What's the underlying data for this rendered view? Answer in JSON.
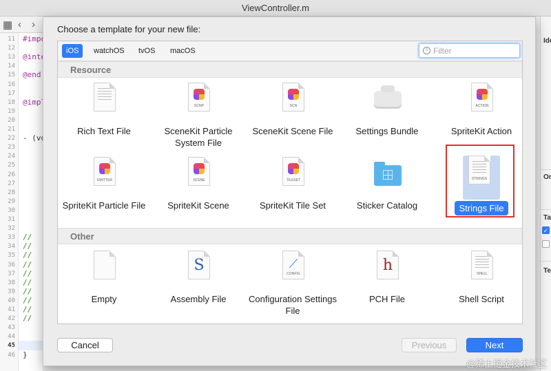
{
  "window": {
    "title": "ViewController.m"
  },
  "editor": {
    "line_numbers": [
      "11",
      "12",
      "13",
      "14",
      "15",
      "16",
      "17",
      "18",
      "19",
      "20",
      "21",
      "22",
      "23",
      "24",
      "25",
      "26",
      "27",
      "28",
      "29",
      "30",
      "31",
      "32",
      "33",
      "34",
      "35",
      "36",
      "37",
      "38",
      "39",
      "40",
      "41",
      "42",
      "43",
      "44",
      "45",
      "46"
    ],
    "current_line": "45",
    "code_fragments": [
      {
        "line": "11",
        "text": "#impo",
        "style": "kw"
      },
      {
        "line": "13",
        "text": "@inte",
        "style": "kw"
      },
      {
        "line": "15",
        "text": "@end",
        "style": "kw"
      },
      {
        "line": "18",
        "text": "@impl",
        "style": "kw"
      },
      {
        "line": "22",
        "text": "- (vo",
        "style": "plain"
      },
      {
        "line": "33",
        "text": "//",
        "style": "cm"
      },
      {
        "line": "34",
        "text": "//",
        "style": "cm"
      },
      {
        "line": "35",
        "text": "//",
        "style": "cm"
      },
      {
        "line": "36",
        "text": "//",
        "style": "cm"
      },
      {
        "line": "37",
        "text": "//",
        "style": "cm"
      },
      {
        "line": "38",
        "text": "//",
        "style": "cm"
      },
      {
        "line": "39",
        "text": "//",
        "style": "cm"
      },
      {
        "line": "40",
        "text": "//",
        "style": "cm"
      },
      {
        "line": "41",
        "text": "//",
        "style": "cm"
      },
      {
        "line": "42",
        "text": "//",
        "style": "cm"
      },
      {
        "line": "46",
        "text": "}",
        "style": "plain"
      }
    ]
  },
  "inspector": {
    "labels": [
      "Ide",
      "On",
      "Tar",
      "Tex"
    ]
  },
  "sheet": {
    "title": "Choose a template for your new file:",
    "tabs": [
      {
        "label": "iOS",
        "selected": true
      },
      {
        "label": "watchOS",
        "selected": false
      },
      {
        "label": "tvOS",
        "selected": false
      },
      {
        "label": "macOS",
        "selected": false
      }
    ],
    "filter": {
      "placeholder": "Filter",
      "value": ""
    },
    "sections": [
      {
        "label": "Resource",
        "items": [
          {
            "label": "Rich Text File",
            "icon": "rich-text-file-icon"
          },
          {
            "label": "SceneKit Particle System File",
            "icon": "scenekit-particle-icon",
            "tag": "SCNP"
          },
          {
            "label": "SceneKit Scene File",
            "icon": "scenekit-scene-icon",
            "tag": "SCN"
          },
          {
            "label": "Settings Bundle",
            "icon": "settings-bundle-icon"
          },
          {
            "label": "SpriteKit Action",
            "icon": "spritekit-action-icon",
            "tag": "ACTION"
          },
          {
            "label": "SpriteKit Particle File",
            "icon": "spritekit-particle-icon",
            "tag": "EMITTER"
          },
          {
            "label": "SpriteKit Scene",
            "icon": "spritekit-scene-icon",
            "tag": "SCENE"
          },
          {
            "label": "SpriteKit Tile Set",
            "icon": "spritekit-tileset-icon",
            "tag": "TILESET"
          },
          {
            "label": "Sticker Catalog",
            "icon": "sticker-catalog-icon"
          },
          {
            "label": "Strings File",
            "icon": "strings-file-icon",
            "tag": "STRINGS",
            "selected": true
          }
        ]
      },
      {
        "label": "Other",
        "items": [
          {
            "label": "Empty",
            "icon": "empty-file-icon"
          },
          {
            "label": "Assembly File",
            "icon": "assembly-file-icon",
            "glyph": "S"
          },
          {
            "label": "Configuration Settings File",
            "icon": "config-file-icon",
            "tag": "CONFIG"
          },
          {
            "label": "PCH File",
            "icon": "pch-file-icon",
            "glyph": "h"
          },
          {
            "label": "Shell Script",
            "icon": "shell-script-icon",
            "tag": "SHELL"
          }
        ]
      }
    ],
    "buttons": {
      "cancel": "Cancel",
      "previous": "Previous",
      "next": "Next"
    }
  },
  "watermark": "@稀土掘金技术社区",
  "colors": {
    "accent": "#2f7cf6",
    "highlight_box": "#e0302a"
  }
}
